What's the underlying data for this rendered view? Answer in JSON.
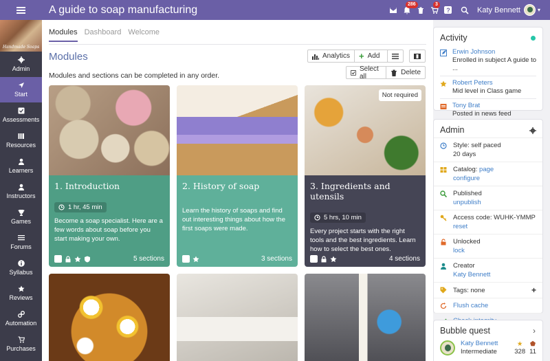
{
  "header": {
    "title": "A guide to soap manufacturing",
    "notifications_badge": "286",
    "cart_badge": "3",
    "help_label": "?",
    "user_name": "Katy Bennett"
  },
  "sidebar": {
    "logo_text": "Handmade Soaps",
    "items": [
      {
        "label": "Admin",
        "icon": "gear-icon"
      },
      {
        "label": "Start",
        "icon": "arrow-icon"
      },
      {
        "label": "Assessments",
        "icon": "checkbox-icon"
      },
      {
        "label": "Resources",
        "icon": "books-icon"
      },
      {
        "label": "Learners",
        "icon": "person-icon"
      },
      {
        "label": "Instructors",
        "icon": "person-icon"
      },
      {
        "label": "Games",
        "icon": "trophy-icon"
      },
      {
        "label": "Forums",
        "icon": "list-icon"
      },
      {
        "label": "Syllabus",
        "icon": "info-icon"
      },
      {
        "label": "Reviews",
        "icon": "star-icon"
      },
      {
        "label": "Automation",
        "icon": "link-icon"
      },
      {
        "label": "Purchases",
        "icon": "cart-icon"
      }
    ],
    "active": "Start"
  },
  "main": {
    "tabs": [
      {
        "label": "Modules",
        "active": true
      },
      {
        "label": "Dashboard",
        "active": false
      },
      {
        "label": "Welcome",
        "active": false
      }
    ],
    "section_title": "Modules",
    "subtitle": "Modules and sections can be completed in any order.",
    "analytics_label": "Analytics",
    "add_label": "Add",
    "select_all_label": "Select all",
    "delete_label": "Delete",
    "cards": [
      {
        "title": "1. Introduction",
        "time": "1 hr, 45 min",
        "description": "Become a soap specialist. Here are a few words about soap before you start making your own.",
        "sections": "5 sections",
        "badge": ""
      },
      {
        "title": "2. History of soap",
        "time": "",
        "description": "Learn the history of soaps and find out interesting things about how the first soaps were made.",
        "sections": "3 sections",
        "badge": ""
      },
      {
        "title": "3. Ingredients and utensils",
        "time": "5 hrs, 10 min",
        "description": "Every project starts with the right tools and the best ingredients. Learn how to select the best ones.",
        "sections": "4 sections",
        "badge": "Not required"
      }
    ]
  },
  "activity": {
    "title": "Activity",
    "items": [
      {
        "name": "Erwin Johnson",
        "text": "Enrolled in subject A guide to ..."
      },
      {
        "name": "Robert Peters",
        "text": "Mid level in Class game"
      },
      {
        "name": "Tony Brat",
        "text": "Posted in news feed"
      }
    ]
  },
  "admin": {
    "title": "Admin",
    "style_line1": "Style: self paced",
    "style_line2": "20 days",
    "catalog_prefix": "Catalog: ",
    "catalog_link": "page",
    "catalog_configure": "configure",
    "published": "Published",
    "unpublish": "unpublish",
    "access_code": "Access code: WUHK-YMMP",
    "reset": "reset",
    "unlocked": "Unlocked",
    "lock": "lock",
    "creator": "Creator",
    "creator_name": "Katy Bennett",
    "tags": "Tags: none",
    "flush_cache": "Flush cache",
    "check_integrity": "Check integrity"
  },
  "bubble_quest": {
    "title": "Bubble quest",
    "user_name": "Katy Bennett",
    "level": "Intermediate",
    "stars": "328",
    "badges": "11"
  },
  "colors": {
    "accent": "#6a5fa6",
    "sidebar_bg": "#3c3c4a",
    "card1": "#4f9e85",
    "card2": "#5fb09a",
    "card3": "#454555",
    "link": "#3f7ec8"
  }
}
